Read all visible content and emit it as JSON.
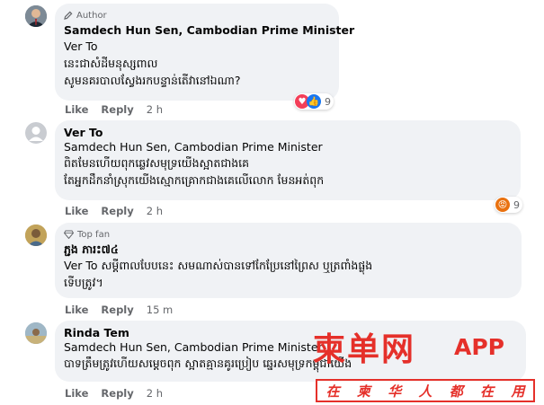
{
  "comments": [
    {
      "badge": "Author",
      "mention": "Samdech Hun Sen, Cambodian Prime Minister",
      "verified": true,
      "lines": [
        "Ver To",
        "នេះជាសំដីមនុស្សពាល",
        "សូមនគរបាលស្វែងរកបន្ទាន់តើវានៅឯណា?"
      ],
      "actions": {
        "like": "Like",
        "reply": "Reply",
        "time": "2 h"
      },
      "reaction_count": "9"
    },
    {
      "author": "Ver To",
      "mention": "Samdech Hun Sen, Cambodian Prime Minister",
      "lines": [
        "ពិតមែនហើយពុកឆ្លេវសមុទ្រយើងស្អាតជាងគេ",
        "តែអ្នកដឹកនាំស្រុកយើងស្មោកគ្រោកជាងគេលើលោក មែនអត់ពុក"
      ],
      "actions": {
        "like": "Like",
        "reply": "Reply",
        "time": "2 h"
      },
      "reaction_count": "9"
    },
    {
      "badge": "Top fan",
      "author": "ភ្ជង ភារះ៧៤",
      "lines": [
        "Ver To សម្ដីពាលបែបនេះ សមណាស់បានទៅកែប្រែនៅព្រៃស ឬត្រពាំងផ្លុង",
        "ទើបត្រូវ។"
      ],
      "actions": {
        "like": "Like",
        "reply": "Reply",
        "time": "15 m"
      }
    },
    {
      "author": "Rinda Tem",
      "mention": "Samdech Hun Sen, Cambodian Prime Minister",
      "lines": [
        "បាទត្រឹមត្រូវហើយសម្ដេចពុក ស្អាតគ្មានគូរប្រៀប ឆ្នេរសមុទ្រកម្ពុជាយើង"
      ],
      "actions": {
        "like": "Like",
        "reply": "Reply",
        "time": "2 h"
      }
    }
  ],
  "watermark": {
    "main": "柬单网",
    "app": "APP",
    "sub": [
      "在",
      "柬",
      "华",
      "人",
      "都",
      "在",
      "用"
    ]
  },
  "colors": {
    "bubble": "#f0f2f5",
    "verified": "#1877f2",
    "love": "#f33e58",
    "like": "#1877f2",
    "angry": "#e9710f",
    "watermark": "#e5302a"
  }
}
